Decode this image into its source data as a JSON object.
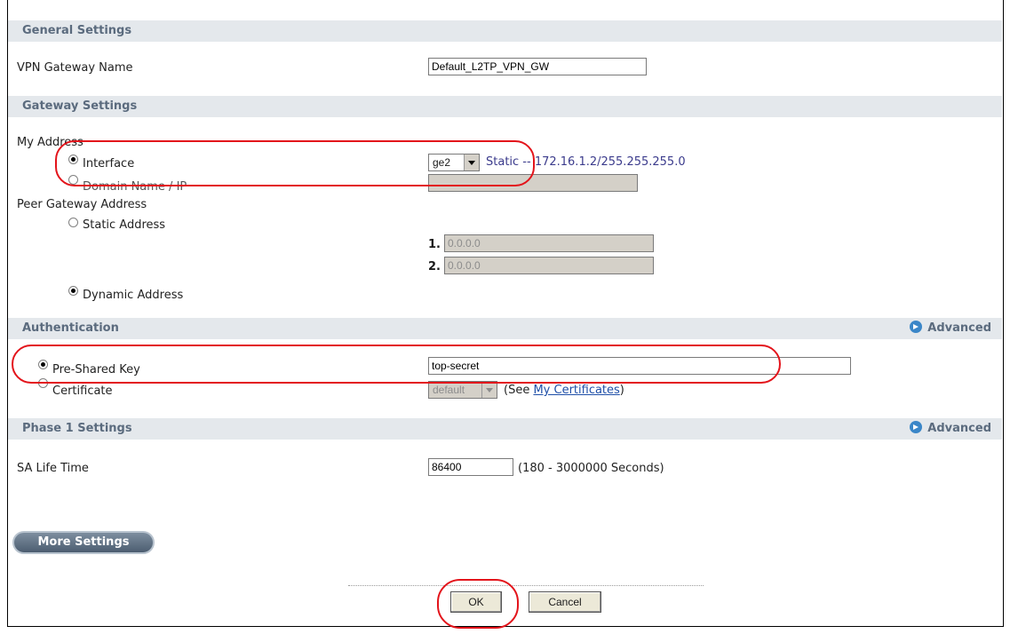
{
  "sections": {
    "general": "General Settings",
    "gateway": "Gateway Settings",
    "auth": "Authentication",
    "phase1": "Phase 1 Settings"
  },
  "advanced_label": "Advanced",
  "general": {
    "vpn_gateway_name_label": "VPN Gateway Name",
    "vpn_gateway_name_value": "Default_L2TP_VPN_GW"
  },
  "gateway": {
    "my_address_label": "My Address",
    "interface_label": "Interface",
    "interface_value": "ge2",
    "interface_info": "Static -- 172.16.1.2/255.255.255.0",
    "domain_label": "Domain Name / IP",
    "peer_label": "Peer Gateway Address",
    "static_address_label": "Static Address",
    "static_1_num": "1.",
    "static_1_value": "0.0.0.0",
    "static_2_num": "2.",
    "static_2_value": "0.0.0.0",
    "dynamic_address_label": "Dynamic Address"
  },
  "auth": {
    "psk_label": "Pre-Shared Key",
    "psk_value": "top-secret",
    "cert_label": "Certificate",
    "cert_value": "default",
    "see_prefix": "(See ",
    "my_certificates": "My Certificates",
    "see_suffix": ")"
  },
  "phase1": {
    "sa_life_label": "SA Life Time",
    "sa_life_value": "86400",
    "sa_life_hint": "(180 - 3000000 Seconds)"
  },
  "buttons": {
    "more_settings": "More Settings",
    "ok": "OK",
    "cancel": "Cancel"
  },
  "colors": {
    "header_bg": "#e4e8ec",
    "header_text": "#5b6b7e",
    "highlight": "#e3141b"
  }
}
